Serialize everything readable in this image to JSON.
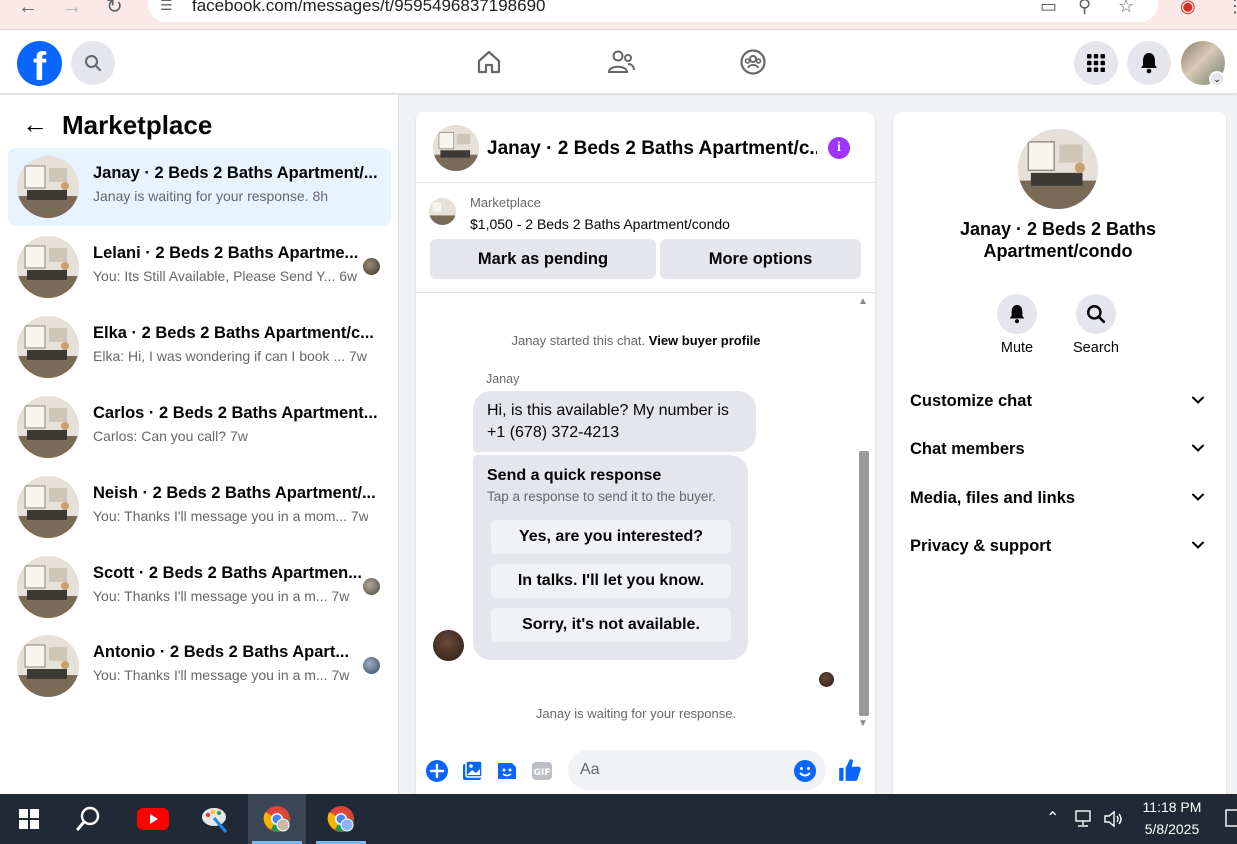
{
  "browser": {
    "url": "facebook.com/messages/t/9595496837198690"
  },
  "left": {
    "title": "Marketplace",
    "conversations": [
      {
        "name": "Janay · 2 Beds 2 Baths Apartment/...",
        "snippet": "Janay is waiting for your response. 8h"
      },
      {
        "name": "Lelani · 2 Beds 2 Baths Apartme...",
        "snippet": "You: Its Still Available, Please Send Y... 6w"
      },
      {
        "name": "Elka · 2 Beds 2 Baths Apartment/c...",
        "snippet": "Elka: Hi, I was wondering if can I book ... 7w"
      },
      {
        "name": "Carlos · 2 Beds 2 Baths Apartment...",
        "snippet": "Carlos: Can you call? 7w"
      },
      {
        "name": "Neish · 2 Beds 2 Baths Apartment/...",
        "snippet": "You: Thanks I'll message you in a mom... 7w"
      },
      {
        "name": "Scott · 2 Beds 2 Baths Apartmen...",
        "snippet": "You: Thanks I'll message you in a m... 7w"
      },
      {
        "name": "Antonio · 2 Beds 2 Baths Apart...",
        "snippet": "You: Thanks I'll message you in a m... 7w"
      }
    ]
  },
  "chat": {
    "title": "Janay · 2 Beds 2 Baths Apartment/c...",
    "marketplace_label": "Marketplace",
    "listing": "$1,050 - 2 Beds 2 Baths Apartment/condo",
    "mark_pending": "Mark as pending",
    "more_options": "More options",
    "started_text": "Janay started this chat.",
    "view_profile": "View buyer profile",
    "sender": "Janay",
    "message": "Hi, is this available? My number is +1 (678) 372-4213",
    "quick_title": "Send a quick response",
    "quick_sub": "Tap a response to send it to the buyer.",
    "quick_options": [
      "Yes, are you interested?",
      "In talks. I'll let you know.",
      "Sorry, it's not available."
    ],
    "waiting": "Janay is waiting for your response.",
    "composer_placeholder": "Aa"
  },
  "right": {
    "name": "Janay · 2 Beds 2 Baths Apartment/condo",
    "mute": "Mute",
    "search": "Search",
    "sections": [
      "Customize chat",
      "Chat members",
      "Media, files and links",
      "Privacy & support"
    ]
  },
  "taskbar": {
    "time": "11:18 PM",
    "date": "5/8/2025"
  },
  "colors": {
    "fb_blue": "#0866ff",
    "active_bg": "#e7f3ff",
    "info_purple": "#a033ff"
  }
}
